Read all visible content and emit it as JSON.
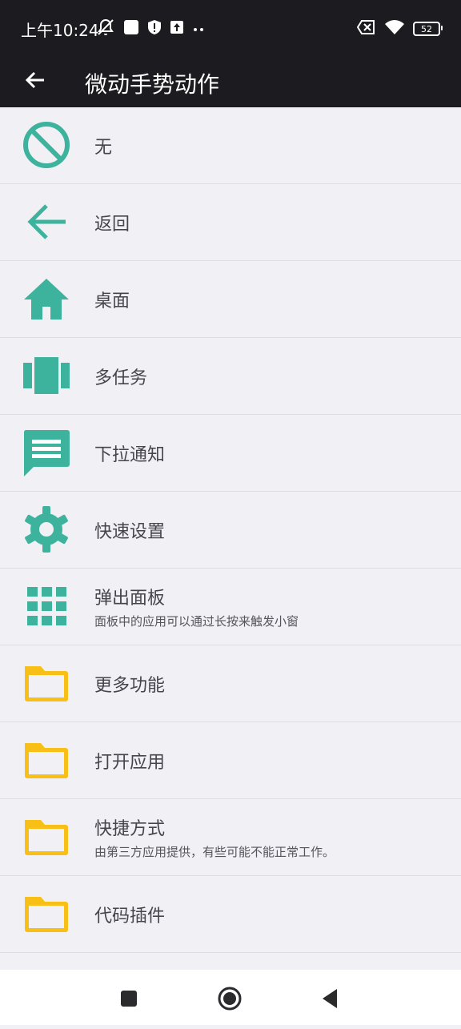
{
  "status_bar": {
    "time": "上午10:24",
    "battery_level": "52",
    "icons": [
      "dnd-off-icon",
      "square-notification-icon",
      "shield-alert-icon",
      "upload-icon",
      "more-dots-icon",
      "sim-off-icon",
      "wifi-icon",
      "battery-icon"
    ]
  },
  "app_bar": {
    "title": "微动手势动作",
    "back_icon": "arrow-back-icon"
  },
  "colors": {
    "accent": "#3db39e",
    "folder": "#f8bf17",
    "bar": "#1c1b1f",
    "background": "#f1f0f4"
  },
  "items": [
    {
      "label": "无",
      "icon": "block-icon"
    },
    {
      "label": "返回",
      "icon": "arrow-left-icon"
    },
    {
      "label": "桌面",
      "icon": "home-icon"
    },
    {
      "label": "多任务",
      "icon": "recents-icon"
    },
    {
      "label": "下拉通知",
      "icon": "notification-message-icon"
    },
    {
      "label": "快速设置",
      "icon": "gear-icon"
    },
    {
      "label": "弹出面板",
      "sublabel": "面板中的应用可以通过长按来触发小窗",
      "icon": "grid-icon"
    },
    {
      "label": "更多功能",
      "icon": "folder-icon"
    },
    {
      "label": "打开应用",
      "icon": "folder-icon"
    },
    {
      "label": "快捷方式",
      "sublabel": "由第三方应用提供，有些可能不能正常工作。",
      "icon": "folder-icon"
    },
    {
      "label": "代码插件",
      "icon": "folder-icon"
    }
  ],
  "nav_bar": {
    "icons": [
      "recents-square-icon",
      "home-circle-icon",
      "back-triangle-icon"
    ]
  }
}
